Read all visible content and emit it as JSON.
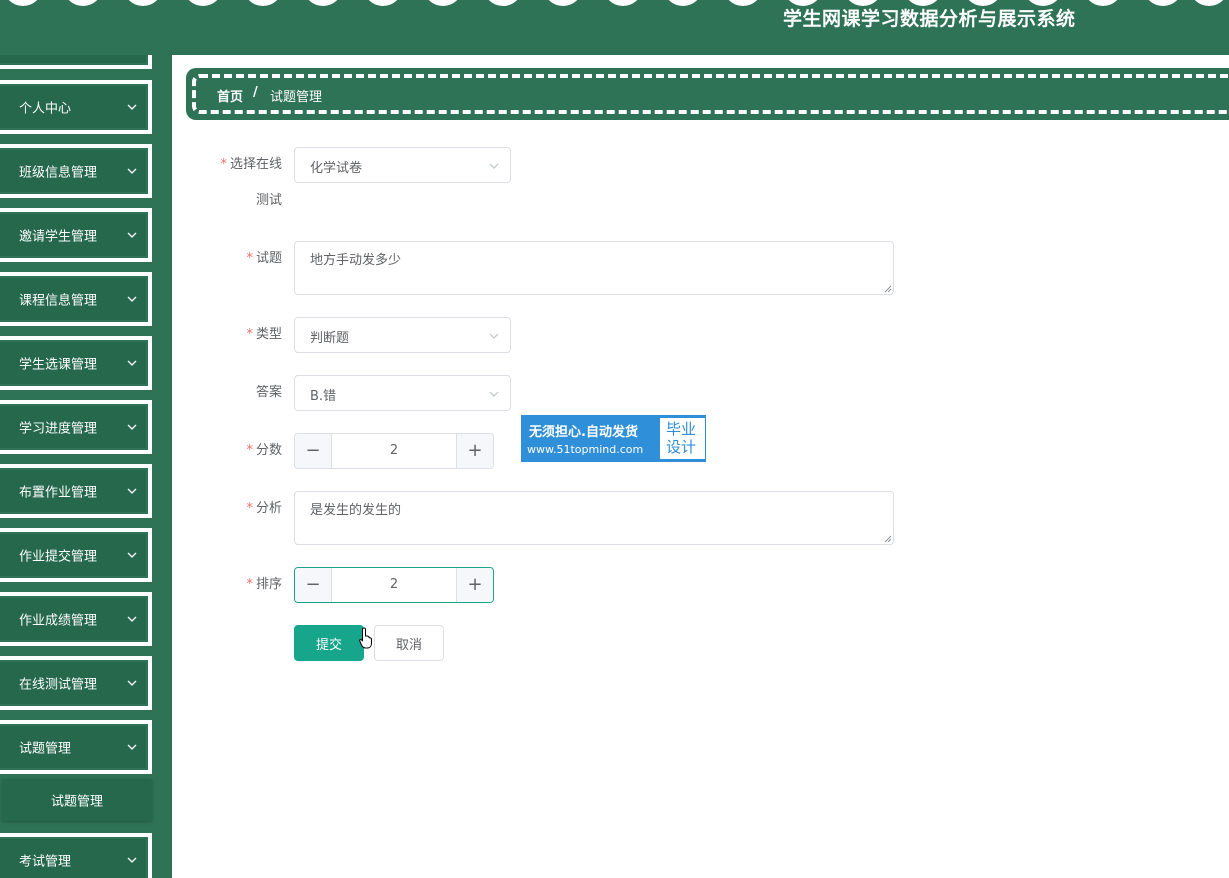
{
  "header": {
    "title": "学生网课学习数据分析与展示系统"
  },
  "sidebar": {
    "items": [
      {
        "label": "个人中心"
      },
      {
        "label": "班级信息管理"
      },
      {
        "label": "邀请学生管理"
      },
      {
        "label": "课程信息管理"
      },
      {
        "label": "学生选课管理"
      },
      {
        "label": "学习进度管理"
      },
      {
        "label": "布置作业管理"
      },
      {
        "label": "作业提交管理"
      },
      {
        "label": "作业成绩管理"
      },
      {
        "label": "在线测试管理"
      },
      {
        "label": "试题管理"
      },
      {
        "label": "考试管理"
      }
    ],
    "submenu": {
      "label": "试题管理"
    }
  },
  "breadcrumb": {
    "home": "首页",
    "separator": "/",
    "current": "试题管理"
  },
  "form": {
    "test_label_line1": "选择在线",
    "test_label_line2": "测试",
    "test_value": "化学试卷",
    "question_label": "试题",
    "question_value": "地方手动发多少",
    "type_label": "类型",
    "type_value": "判断题",
    "answer_label": "答案",
    "answer_value": "B.错",
    "score_label": "分数",
    "score_value": "2",
    "analysis_label": "分析",
    "analysis_value": "是发生的发生的",
    "order_label": "排序",
    "order_value": "2",
    "required_mark": "*",
    "minus": "−",
    "plus": "+",
    "submit_label": "提交",
    "cancel_label": "取消"
  },
  "watermark": {
    "line1": "无须担心.自动发货",
    "line2": "www.51topmind.com",
    "side": "毕业设计"
  },
  "colors": {
    "primary": "#2e7356",
    "accent": "#17a58c",
    "required": "#f56c6c",
    "watermark": "#2f8fd8"
  }
}
